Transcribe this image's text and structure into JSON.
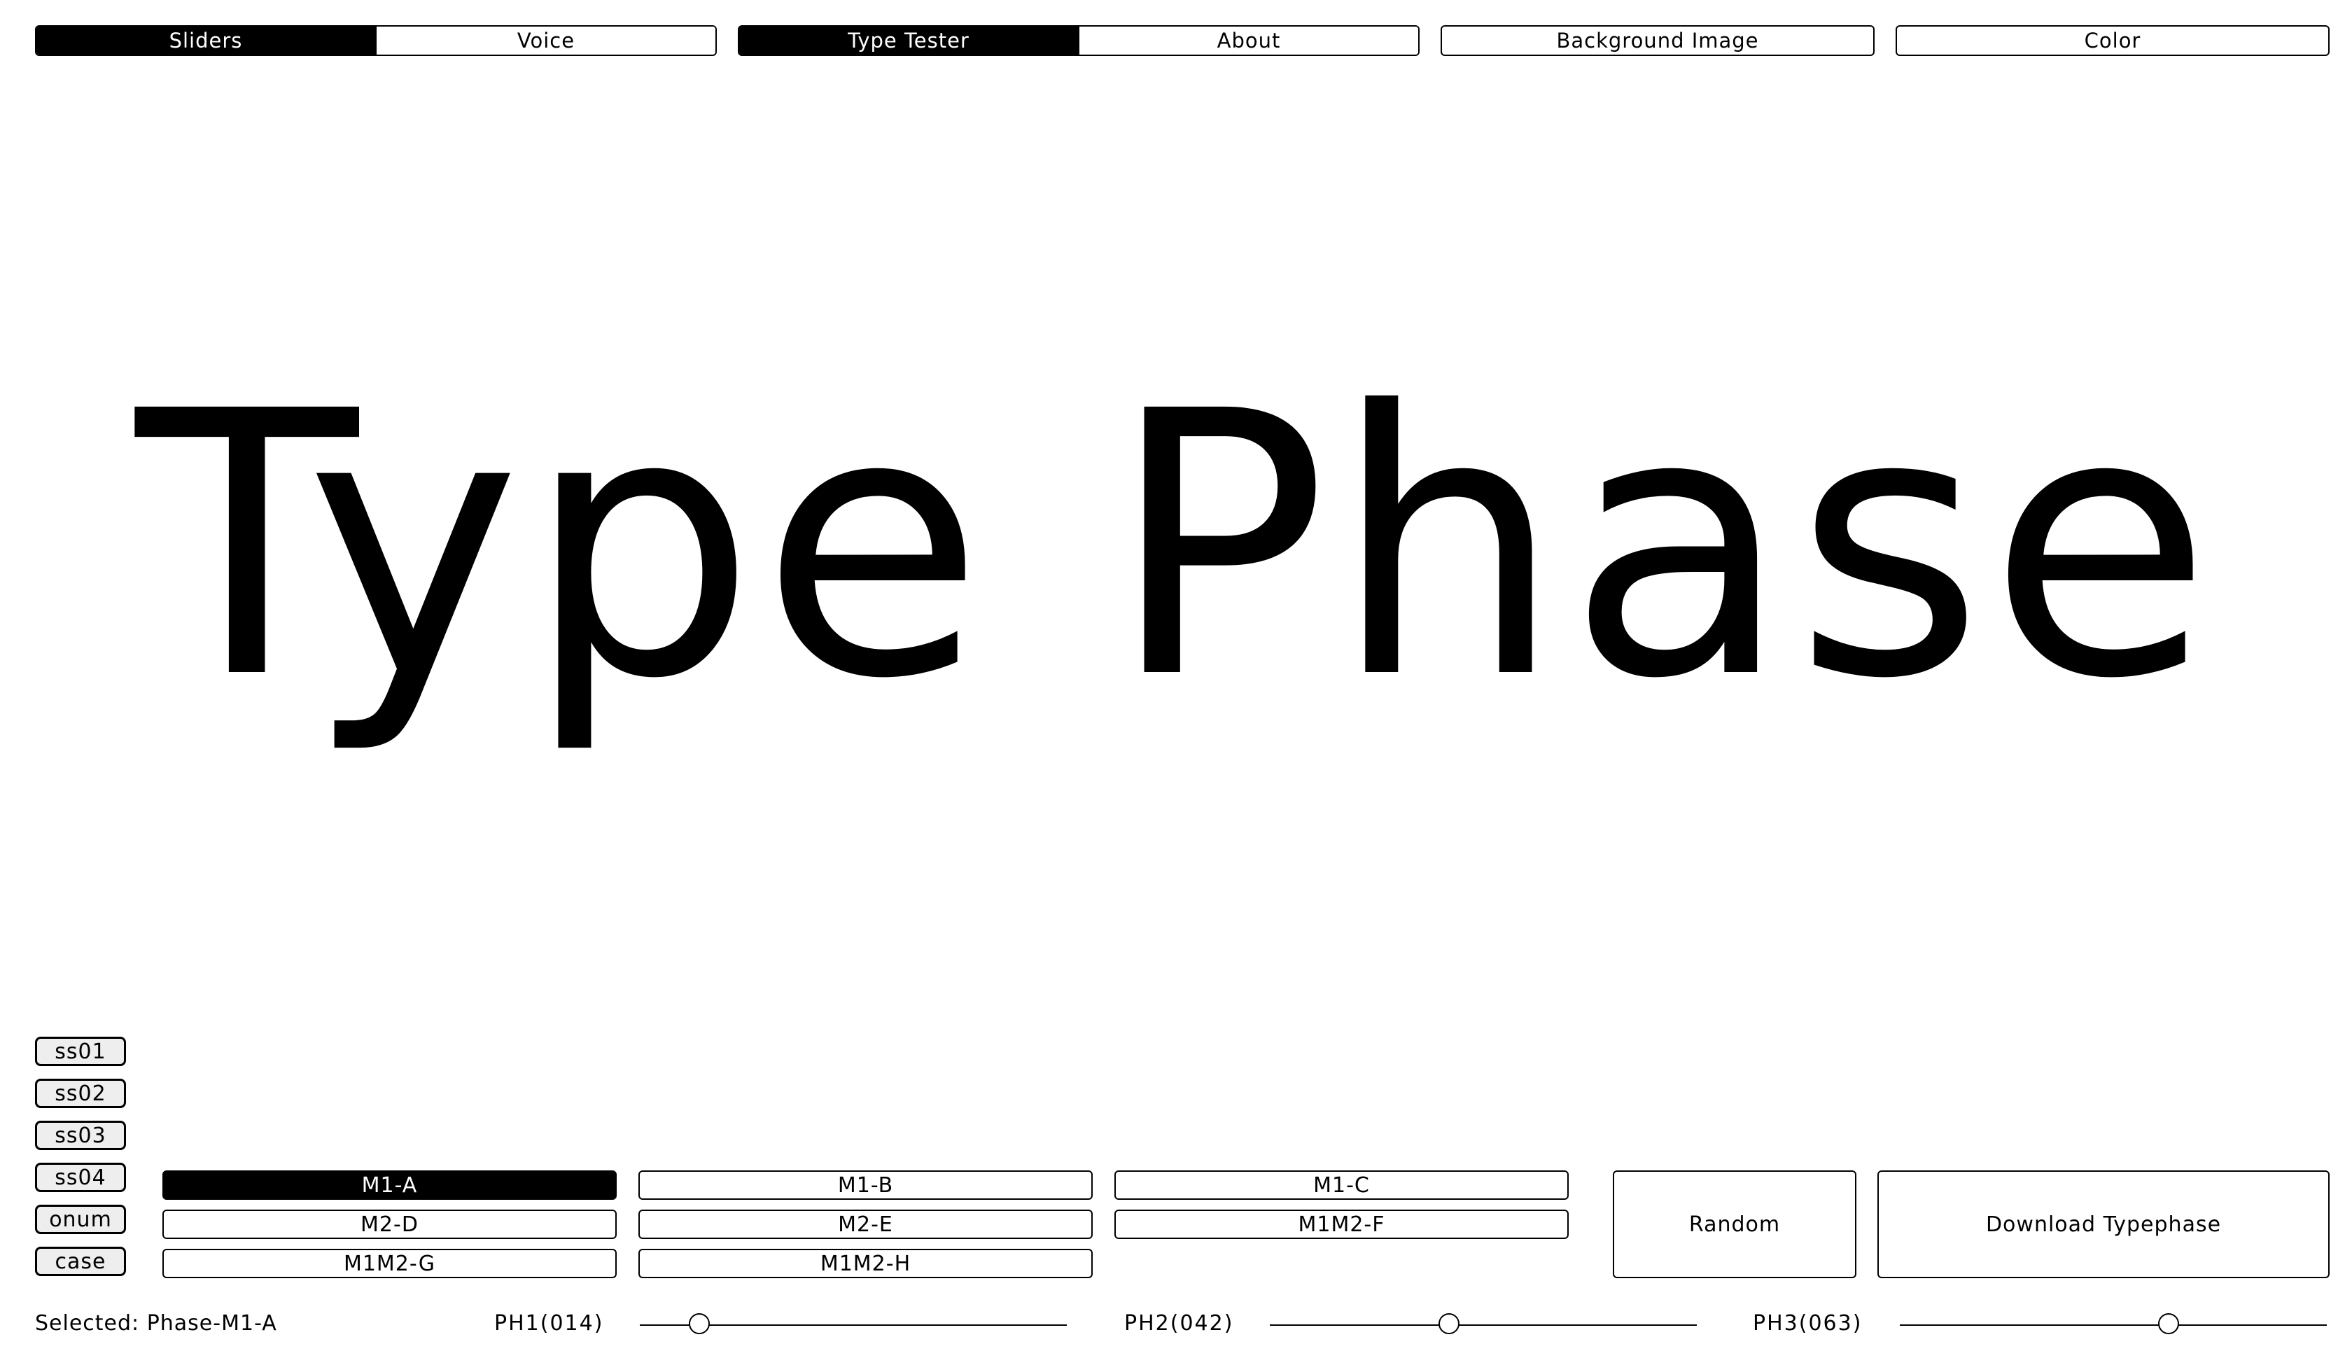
{
  "tabs_left": {
    "items": [
      "Sliders",
      "Voice"
    ],
    "active": 0
  },
  "tabs_mid": {
    "items": [
      "Type Tester",
      "About"
    ],
    "active": 0
  },
  "background_button": "Background Image",
  "color_button": "Color",
  "specimen_text": "Type Phase",
  "features": [
    "ss01",
    "ss02",
    "ss03",
    "ss04",
    "onum",
    "case"
  ],
  "phases": {
    "row1": [
      "M1-A",
      "M1-B",
      "M1-C"
    ],
    "row2": [
      "M2-D",
      "M2-E",
      "M1M2-F"
    ],
    "row3": [
      "M1M2-G",
      "M1M2-H"
    ],
    "active": "M1-A"
  },
  "random_button": "Random",
  "download_button": "Download Typephase",
  "status_text": "Selected: Phase-M1-A",
  "sliders": [
    {
      "label": "PH1(014)",
      "value": 14
    },
    {
      "label": "PH2(042)",
      "value": 42
    },
    {
      "label": "PH3(063)",
      "value": 63
    }
  ],
  "slider_max": 100
}
